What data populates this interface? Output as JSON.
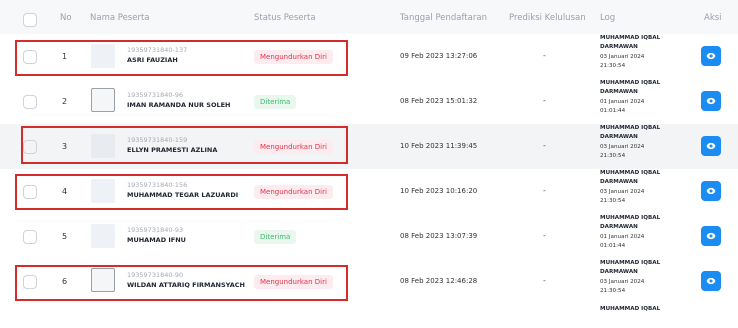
{
  "headers": {
    "no": "No",
    "nama": "Nama Peserta",
    "status": "Status Peserta",
    "tanggal": "Tanggal Pendaftaran",
    "prediksi": "Prediksi Kelulusan",
    "log": "Log",
    "aksi": "Aksi"
  },
  "rows": [
    {
      "no": "1",
      "id": "19359731840-137",
      "name": "ASRI FAUZIAH",
      "status": "Mengundurkan Diri",
      "date": "09 Feb 2023 13:27:06",
      "prediksi": "-",
      "log_l1": "MUHAMMAD IQBAL",
      "log_l2": "DARMAWAN",
      "log_l3": "03 Januari 2024",
      "log_l4": "21:30:54"
    },
    {
      "no": "2",
      "id": "19359731840-96",
      "name": "IMAN RAMANDA NUR SOLEH",
      "status": "Diterima",
      "date": "08 Feb 2023 15:01:32",
      "prediksi": "-",
      "log_l1": "MUHAMMAD IQBAL",
      "log_l2": "DARMAWAN",
      "log_l3": "01 Januari 2024",
      "log_l4": "01:01:44"
    },
    {
      "no": "3",
      "id": "19359731840-159",
      "name": "ELLYN PRAMESTI AZLINA",
      "status": "Mengundurkan Diri",
      "date": "10 Feb 2023 11:39:45",
      "prediksi": "-",
      "log_l1": "MUHAMMAD IQBAL",
      "log_l2": "DARMAWAN",
      "log_l3": "03 Januari 2024",
      "log_l4": "21:30:54"
    },
    {
      "no": "4",
      "id": "19359731840-156",
      "name": "MUHAMMAD TEGAR LAZUARDI",
      "status": "Mengundurkan Diri",
      "date": "10 Feb 2023 10:16:20",
      "prediksi": "-",
      "log_l1": "MUHAMMAD IQBAL",
      "log_l2": "DARMAWAN",
      "log_l3": "03 Januari 2024",
      "log_l4": "21:30:54"
    },
    {
      "no": "5",
      "id": "19359731840-93",
      "name": "MUHAMAD IFNU",
      "status": "Diterima",
      "date": "08 Feb 2023 13:07:39",
      "prediksi": "-",
      "log_l1": "MUHAMMAD IQBAL",
      "log_l2": "DARMAWAN",
      "log_l3": "01 Januari 2024",
      "log_l4": "01:01:44"
    },
    {
      "no": "6",
      "id": "19359731840-90",
      "name": "WILDAN ATTARIQ FIRMANSYACH",
      "status": "Mengundurkan Diri",
      "date": "08 Feb 2023 12:46:28",
      "prediksi": "-",
      "log_l1": "MUHAMMAD IQBAL",
      "log_l2": "DARMAWAN",
      "log_l3": "03 Januari 2024",
      "log_l4": "21:30:54"
    }
  ],
  "partial_log": "MUHAMMAD IQBAL",
  "colors": {
    "badge_red": "#e2334b",
    "badge_green": "#3cba6b",
    "action_blue": "#1a8cf2",
    "highlight": "#d22c2c"
  },
  "icons": {
    "action": "eye-icon"
  }
}
